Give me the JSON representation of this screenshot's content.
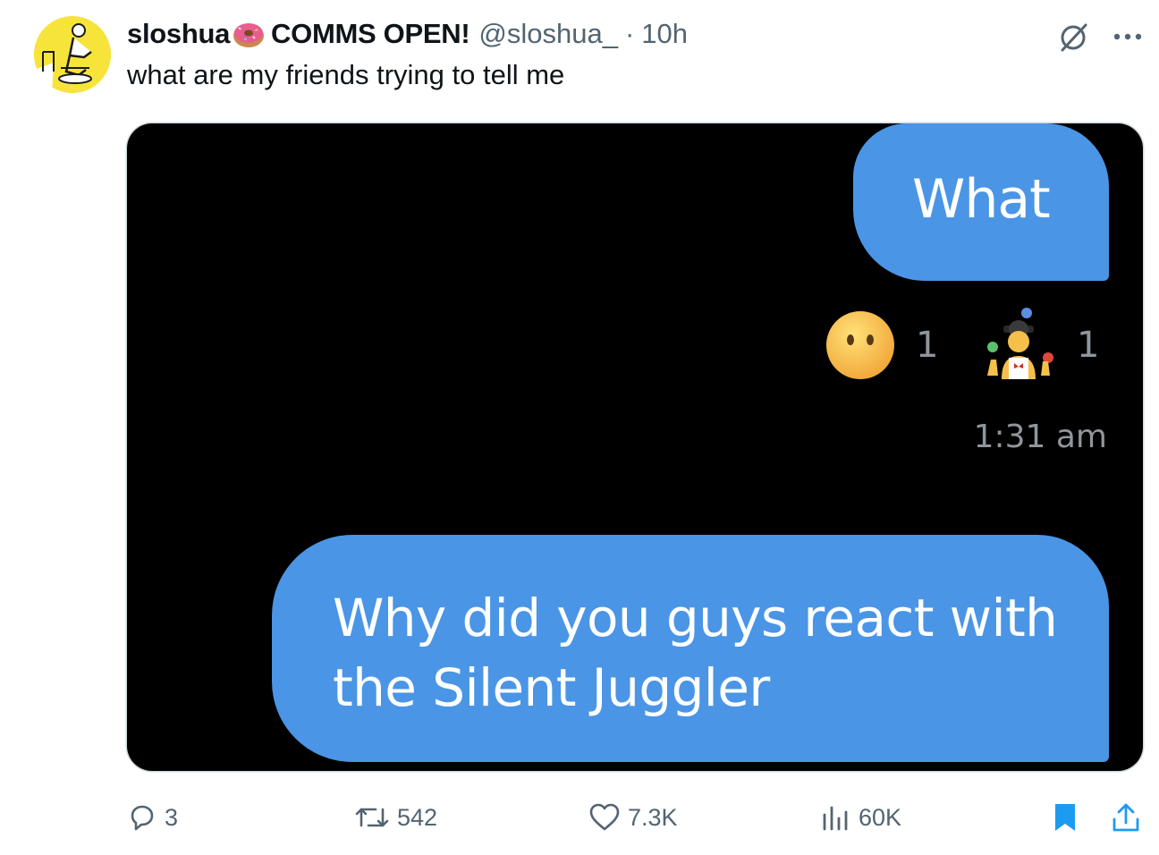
{
  "tweet": {
    "display_name": "sloshua",
    "display_name_suffix": "COMMS OPEN!",
    "handle": "@sloshua_",
    "separator": "·",
    "time": "10h",
    "text": "what are my friends trying to tell me"
  },
  "media": {
    "messages": [
      {
        "text": "What"
      },
      {
        "text": "Why did you guys react with the Silent Juggler"
      }
    ],
    "reactions": [
      {
        "emoji": "face-without-mouth-emoji",
        "count": "1"
      },
      {
        "emoji": "woman-juggling-emoji",
        "count": "1"
      }
    ],
    "timestamp": "1:31 am",
    "bubble_color": "#4a95e6",
    "background": "#000000"
  },
  "actions": {
    "replies": "3",
    "reposts": "542",
    "likes": "7.3K",
    "views": "60K"
  },
  "icons": {
    "reply": "reply-icon",
    "repost": "repost-icon",
    "like": "heart-icon",
    "views": "views-chart-icon",
    "bookmark": "bookmark-icon",
    "share": "share-icon",
    "grok": "grok-icon",
    "more": "more-icon",
    "badge": "donut-emoji"
  },
  "colors": {
    "accent": "#1d9bf0",
    "muted": "#536471",
    "text": "#0f1419",
    "avatar_bg": "#f7e43a"
  }
}
